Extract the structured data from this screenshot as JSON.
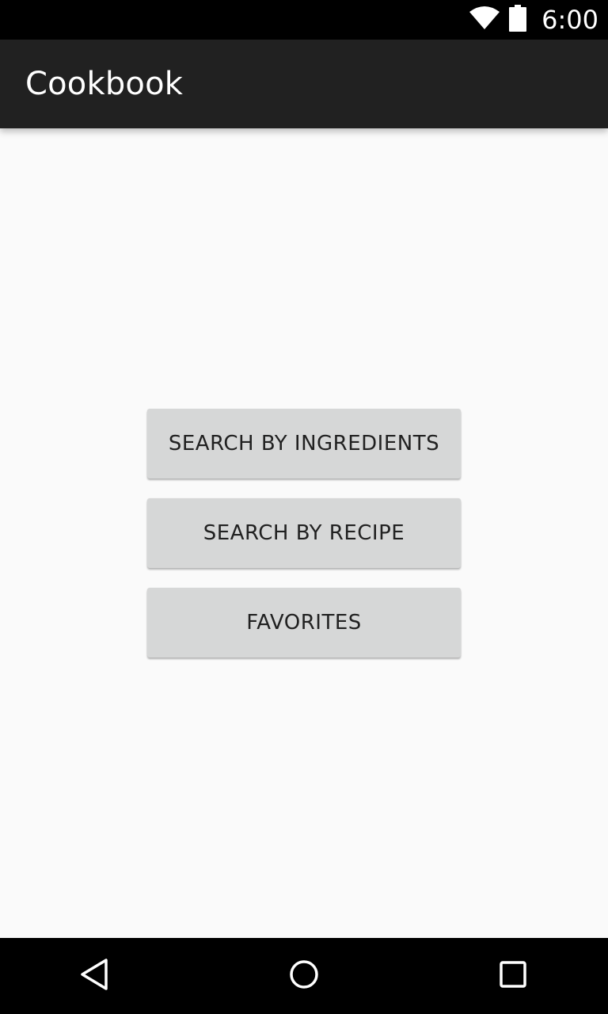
{
  "status_bar": {
    "time": "6:00",
    "icons": [
      "wifi-icon",
      "battery-icon"
    ]
  },
  "app_bar": {
    "title": "Cookbook"
  },
  "main": {
    "buttons": [
      {
        "label": "SEARCH BY INGREDIENTS"
      },
      {
        "label": "SEARCH BY RECIPE"
      },
      {
        "label": "FAVORITES"
      }
    ]
  },
  "nav_bar": {
    "icons": [
      "back-icon",
      "home-icon",
      "recents-icon"
    ]
  },
  "colors": {
    "status_bar_bg": "#000000",
    "app_bar_bg": "#212121",
    "background": "#fafafa",
    "button_bg": "#d6d7d7",
    "button_text": "#212121",
    "nav_bar_bg": "#000000"
  }
}
